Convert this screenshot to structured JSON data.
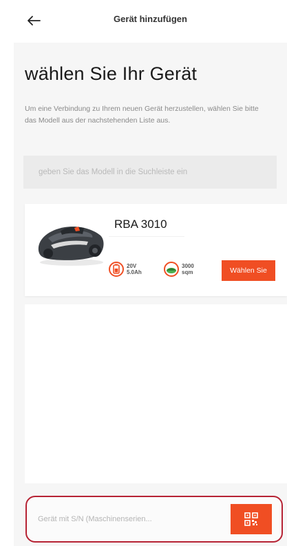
{
  "header": {
    "title": "Gerät hinzufügen",
    "back_icon": "arrow-left-icon"
  },
  "main": {
    "title": "wählen Sie Ihr Gerät",
    "intro": "Um eine Verbindung zu Ihrem neuen Gerät herzustellen, wählen Sie bitte das Modell aus der nachstehenden Liste aus.",
    "search_placeholder": "geben Sie das Modell in die Suchleiste ein"
  },
  "devices": [
    {
      "model": "RBA 3010",
      "specs": [
        {
          "icon": "battery-icon",
          "line1": "20V",
          "line2": "5.0Ah"
        },
        {
          "icon": "lawn-area-icon",
          "line1": "3000",
          "line2": "sqm"
        }
      ],
      "select_label": "Wählen Sie"
    }
  ],
  "footer": {
    "sn_placeholder": "Gerät mit S/N (Maschinenserien...",
    "qr_icon": "qr-scan-icon"
  },
  "colors": {
    "accent": "#f04e23",
    "highlight_border": "#b62233",
    "background": "#f6f6f6"
  }
}
